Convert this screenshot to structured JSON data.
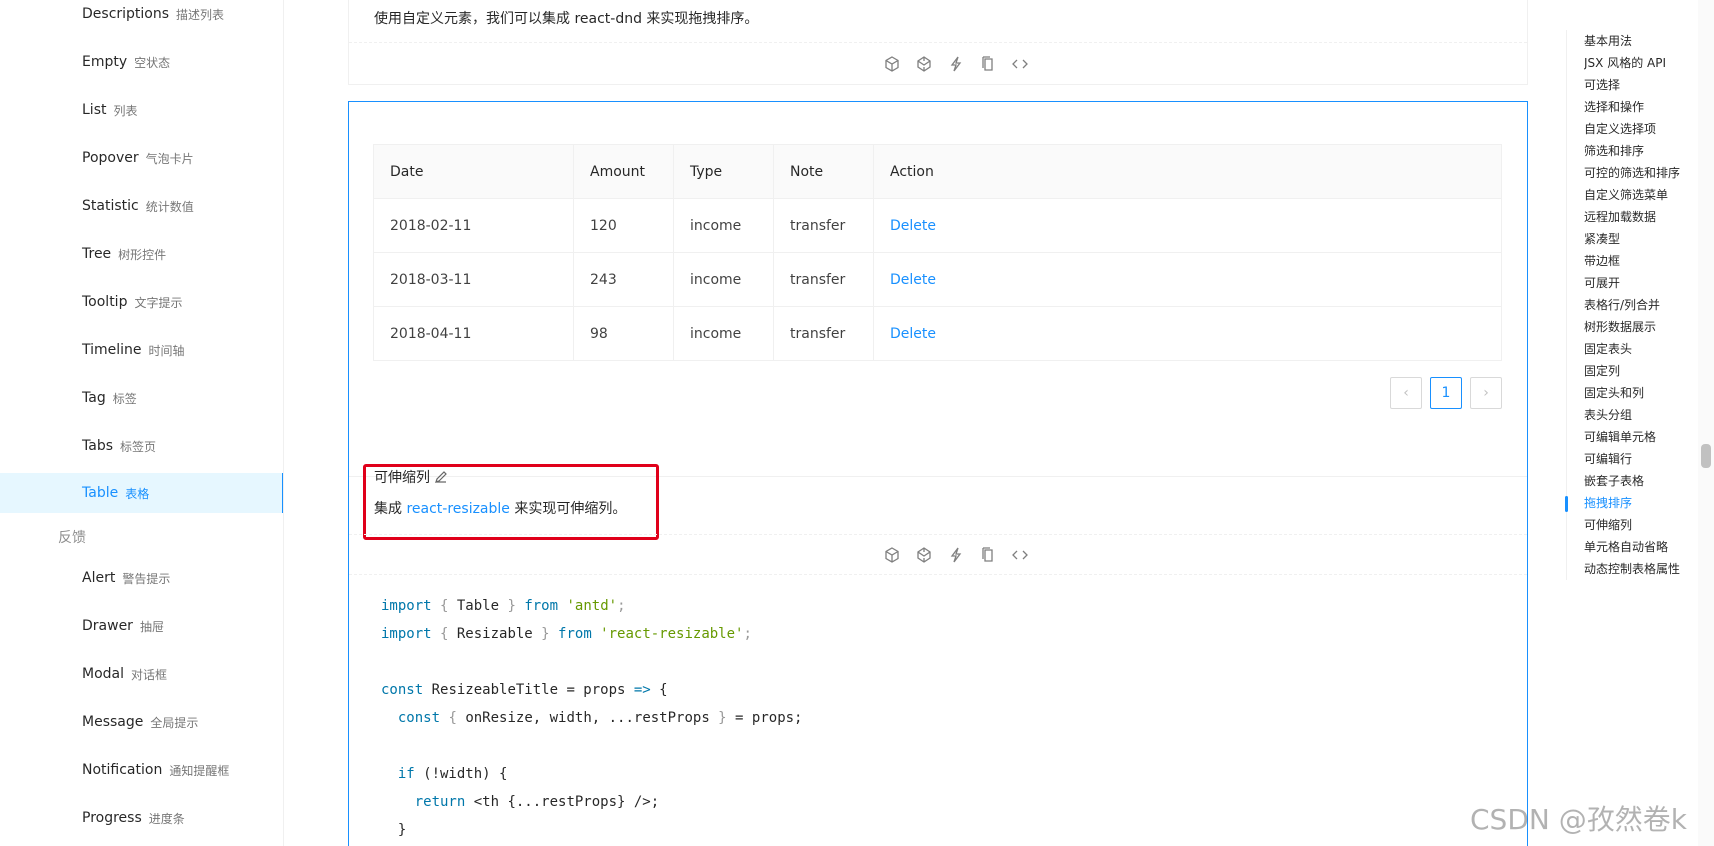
{
  "sidebar": {
    "items": [
      {
        "en": "Descriptions",
        "zh": "描述列表"
      },
      {
        "en": "Empty",
        "zh": "空状态"
      },
      {
        "en": "List",
        "zh": "列表"
      },
      {
        "en": "Popover",
        "zh": "气泡卡片"
      },
      {
        "en": "Statistic",
        "zh": "统计数值"
      },
      {
        "en": "Tree",
        "zh": "树形控件"
      },
      {
        "en": "Tooltip",
        "zh": "文字提示"
      },
      {
        "en": "Timeline",
        "zh": "时间轴"
      },
      {
        "en": "Tag",
        "zh": "标签"
      },
      {
        "en": "Tabs",
        "zh": "标签页"
      },
      {
        "en": "Table",
        "zh": "表格"
      }
    ],
    "group_feedback": "反馈",
    "feedback_items": [
      {
        "en": "Alert",
        "zh": "警告提示"
      },
      {
        "en": "Drawer",
        "zh": "抽屉"
      },
      {
        "en": "Modal",
        "zh": "对话框"
      },
      {
        "en": "Message",
        "zh": "全局提示"
      },
      {
        "en": "Notification",
        "zh": "通知提醒框"
      },
      {
        "en": "Progress",
        "zh": "进度条"
      }
    ]
  },
  "prev_demo": {
    "description": "使用自定义元素，我们可以集成 react-dnd 来实现拖拽排序。"
  },
  "table": {
    "headers": [
      "Date",
      "Amount",
      "Type",
      "Note",
      "Action"
    ],
    "rows": [
      {
        "date": "2018-02-11",
        "amount": "120",
        "type": "income",
        "note": "transfer",
        "action": "Delete"
      },
      {
        "date": "2018-03-11",
        "amount": "243",
        "type": "income",
        "note": "transfer",
        "action": "Delete"
      },
      {
        "date": "2018-04-11",
        "amount": "98",
        "type": "income",
        "note": "transfer",
        "action": "Delete"
      }
    ]
  },
  "pagination": {
    "prev": "‹",
    "current": "1",
    "next": "›"
  },
  "demo": {
    "title": "可伸缩列",
    "desc_prefix": "集成 ",
    "desc_link": "react-resizable",
    "desc_suffix": " 来实现可伸缩列。"
  },
  "code": {
    "l1_import": "import",
    "l1_open": " { ",
    "l1_name": "Table",
    "l1_close": " } ",
    "l1_from": "from",
    "l1_str": " 'antd'",
    "l1_end": ";",
    "l2_import": "import",
    "l2_open": " { ",
    "l2_name": "Resizable",
    "l2_close": " } ",
    "l2_from": "from",
    "l2_str": " 'react-resizable'",
    "l2_end": ";",
    "l4_const": "const",
    "l4_rest": " ResizeableTitle = props ",
    "l4_arrow": "=>",
    "l4_brace": " {",
    "l5_const": "  const",
    "l5_open": " { ",
    "l5_rest": "onResize, width, ...restProps",
    "l5_close": " } ",
    "l5_end": "= props;",
    "l7_if": "  if",
    "l7_rest": " (!width) {",
    "l8_return": "    return",
    "l8_rest": " <th {...restProps} />;",
    "l9_close": "  }"
  },
  "anchor": {
    "items": [
      "基本用法",
      "JSX 风格的 API",
      "可选择",
      "选择和操作",
      "自定义选择项",
      "筛选和排序",
      "可控的筛选和排序",
      "自定义筛选菜单",
      "远程加载数据",
      "紧凑型",
      "带边框",
      "可展开",
      "表格行/列合并",
      "树形数据展示",
      "固定表头",
      "固定列",
      "固定头和列",
      "表头分组",
      "可编辑单元格",
      "可编辑行",
      "嵌套子表格",
      "拖拽排序",
      "可伸缩列",
      "单元格自动省略",
      "动态控制表格属性"
    ],
    "active": "拖拽排序"
  },
  "watermark": "CSDN @孜然卷k",
  "colors": {
    "primary": "#1890ff",
    "highlight": "#e0001a"
  }
}
